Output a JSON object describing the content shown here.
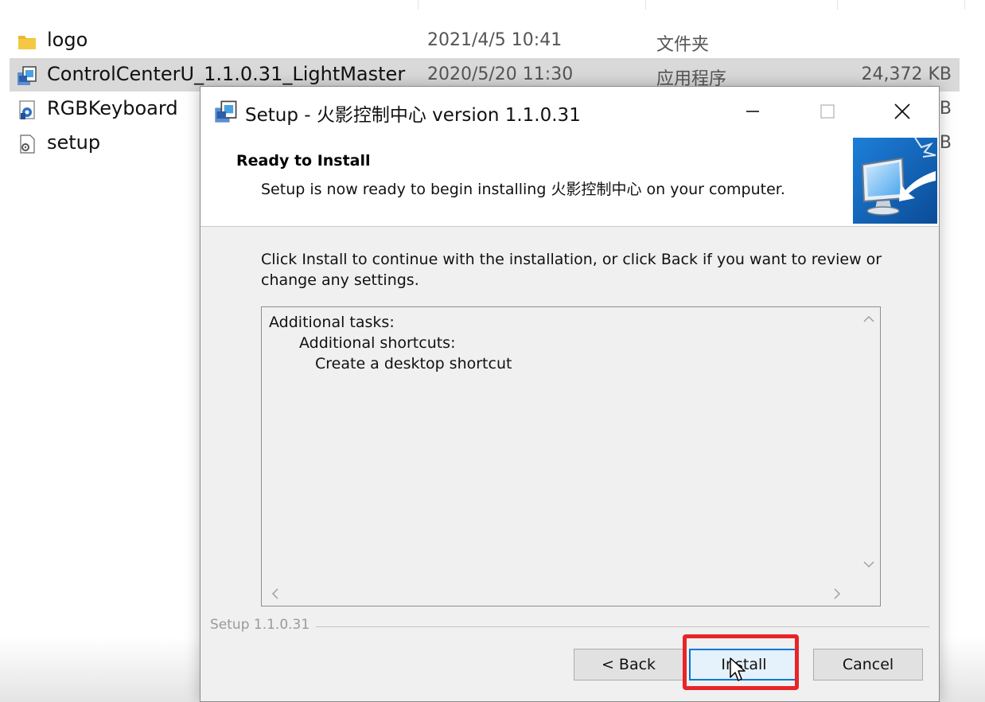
{
  "explorer": {
    "files": [
      {
        "name": "logo",
        "date": "2021/4/5 10:41",
        "type": "文件夹",
        "size": "",
        "icon": "folder-icon",
        "selected": false
      },
      {
        "name": "ControlCenterU_1.1.0.31_LightMaster",
        "date": "2020/5/20 11:30",
        "type": "应用程序",
        "size": "24,372 KB",
        "icon": "installer-icon",
        "selected": true
      },
      {
        "name": "RGBKeyboard",
        "date": "",
        "type": "",
        "size": "KB",
        "icon": "app-icon",
        "selected": false
      },
      {
        "name": "setup",
        "date": "",
        "type": "",
        "size": "KB",
        "icon": "config-file-icon",
        "selected": false
      }
    ]
  },
  "dialog": {
    "title": "Setup - 火影控制中心 version 1.1.0.31",
    "header_title": "Ready to Install",
    "header_subtitle": "Setup is now ready to begin installing 火影控制中心 on your computer.",
    "instructions": "Click Install to continue with the installation, or click Back if you want to review or change any settings.",
    "memo": {
      "line1": "Additional tasks:",
      "line2": "Additional shortcuts:",
      "line3": "Create a desktop shortcut"
    },
    "version_label": "Setup 1.1.0.31",
    "buttons": {
      "back": "< Back",
      "install": "Install",
      "cancel": "Cancel"
    }
  },
  "colors": {
    "highlight": "#e8242a",
    "focus": "#0078d7",
    "selected_row": "#d9d9d9"
  }
}
